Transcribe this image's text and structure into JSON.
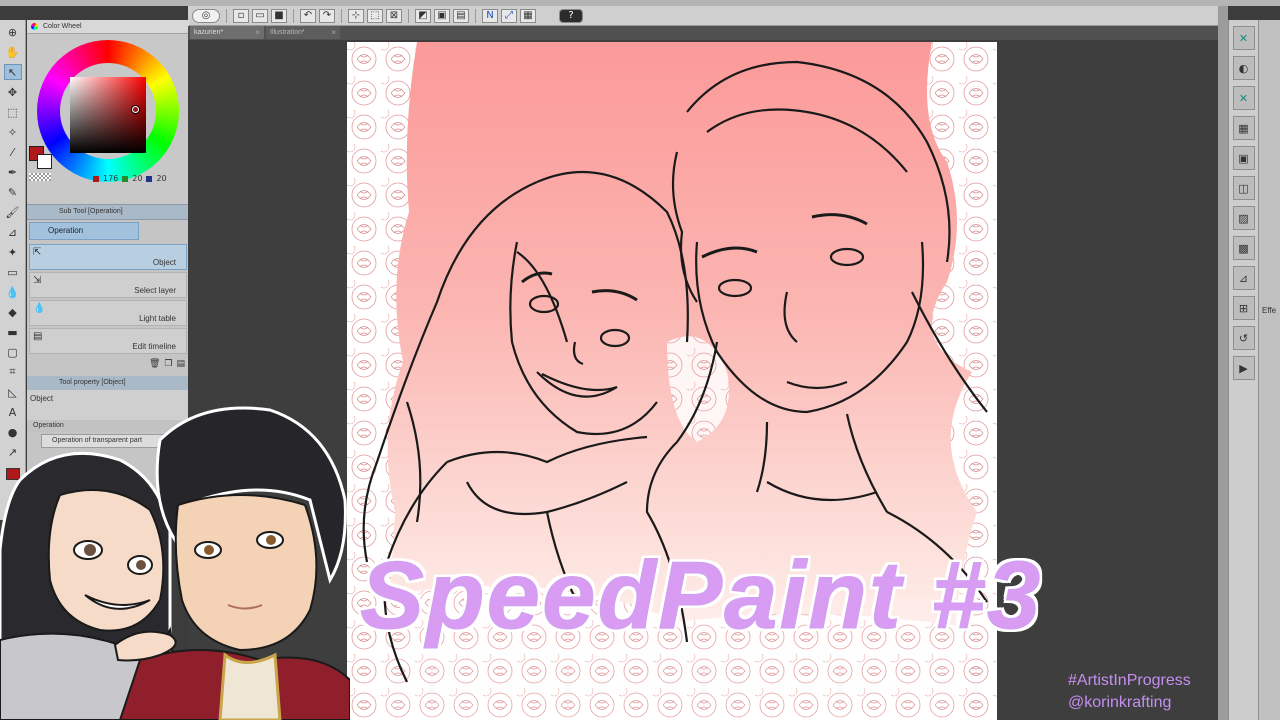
{
  "app": {
    "toolbar_icons": [
      "logo-icon",
      "new-file-icon",
      "open-file-icon",
      "save-icon",
      "undo-icon",
      "redo-icon",
      "transform-icon",
      "select-icon",
      "clear-icon",
      "help-icon"
    ],
    "help_label": "?"
  },
  "color_wheel": {
    "title": "Color Wheel",
    "main_color": "#b0191b",
    "sub_color": "#ffffff",
    "r": "176",
    "g": "20",
    "b": "20"
  },
  "subtool": {
    "header": "Sub Tool [Operation]",
    "group_tab": "Operation",
    "items": [
      {
        "label": "Object",
        "icon": "object-cursor-icon",
        "active": true
      },
      {
        "label": "Select layer",
        "icon": "select-layer-icon",
        "active": false
      },
      {
        "label": "Light table",
        "icon": "light-table-icon",
        "active": false
      },
      {
        "label": "Edit timeline",
        "icon": "edit-timeline-icon",
        "active": false
      }
    ]
  },
  "tool_property": {
    "header": "Tool property [Object]",
    "name": "Object",
    "section": "Operation",
    "option": "Operation of transparent part"
  },
  "document_tabs": [
    {
      "label": "kazurien*",
      "active": true
    },
    {
      "label": "Illustration*",
      "active": false
    }
  ],
  "right_panel": {
    "edge_label": "Effe"
  },
  "overlay": {
    "title": "SpeedPaint #3",
    "hashtag": "#ArtistInProgress",
    "handle": "@korinkrafting",
    "title_color": "#d99cf3",
    "caption_color": "#c58ff0"
  }
}
